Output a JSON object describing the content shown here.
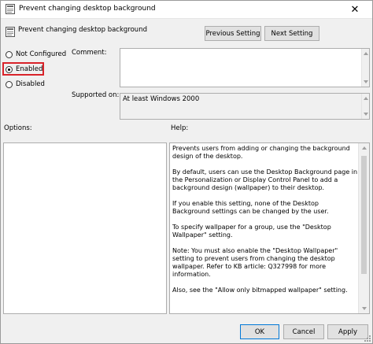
{
  "window": {
    "title": "Prevent changing desktop background",
    "close_glyph": "✕"
  },
  "header": {
    "policy_name": "Prevent changing desktop background",
    "prev_label": "Previous Setting",
    "next_label": "Next Setting"
  },
  "state": {
    "options": [
      {
        "label": "Not Configured",
        "checked": false
      },
      {
        "label": "Enabled",
        "checked": true
      },
      {
        "label": "Disabled",
        "checked": false
      }
    ],
    "highlight_color": "#d9232a"
  },
  "comment": {
    "label": "Comment:",
    "value": ""
  },
  "supported": {
    "label": "Supported on:",
    "value": "At least Windows 2000"
  },
  "options_panel": {
    "label": "Options:"
  },
  "help": {
    "label": "Help:",
    "paragraphs": [
      "Prevents users from adding or changing the background design of the desktop.",
      "By default, users can use the Desktop Background page in the Personalization or Display Control Panel to add a background design (wallpaper) to their desktop.",
      "If you enable this setting, none of the Desktop Background settings can be changed by the user.",
      "To specify wallpaper for a group, use the \"Desktop Wallpaper\" setting.",
      "Note: You must also enable the \"Desktop Wallpaper\" setting to prevent users from changing the desktop wallpaper. Refer to KB article: Q327998 for more information.",
      "Also, see the \"Allow only bitmapped wallpaper\" setting."
    ]
  },
  "footer": {
    "ok_label": "OK",
    "cancel_label": "Cancel",
    "apply_label": "Apply",
    "accent_color": "#0078d7"
  }
}
